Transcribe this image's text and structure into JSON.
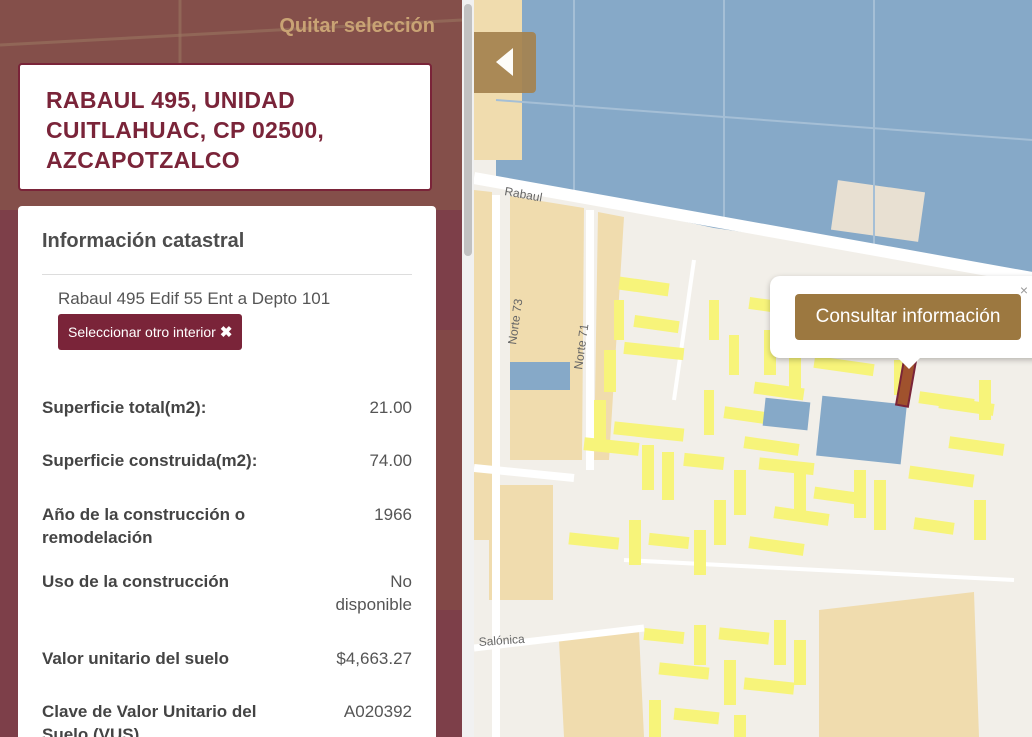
{
  "panel": {
    "clear_selection": "Quitar selección",
    "address": "RABAUL 495, UNIDAD CUITLAHUAC, CP 02500, AZCAPOTZALCO",
    "info_title": "Información catastral",
    "interior": "Rabaul 495 Edif 55 Ent a Depto 101",
    "select_other_interior": "Seleccionar otro interior",
    "rows": [
      {
        "label": "Superficie total(m2):",
        "value": "21.00"
      },
      {
        "label": "Superficie construida(m2):",
        "value": "74.00"
      },
      {
        "label": "Año de la construcción o remodelación",
        "value": "1966"
      },
      {
        "label": "Uso de la construcción",
        "value": "No disponible"
      },
      {
        "label": "Valor unitario del suelo",
        "value": "$4,663.27"
      },
      {
        "label": "Clave de Valor Unitario del Suelo (VUS)",
        "value": "A020392"
      }
    ]
  },
  "map": {
    "popup_button": "Consultar información",
    "popup_close": "×",
    "streets": {
      "rabaul": "Rabaul",
      "norte73": "Norte 73",
      "norte71": "Norte 71",
      "salonica": "Salónica"
    }
  },
  "icons": {
    "close": "close-x-icon",
    "collapse": "chevron-left-icon"
  },
  "colors": {
    "maroon": "#7a2439",
    "gold": "#9c7840",
    "water_blue": "#86a9c8",
    "building_yellow": "#f7f47a",
    "block_tan": "#f0dcae"
  }
}
